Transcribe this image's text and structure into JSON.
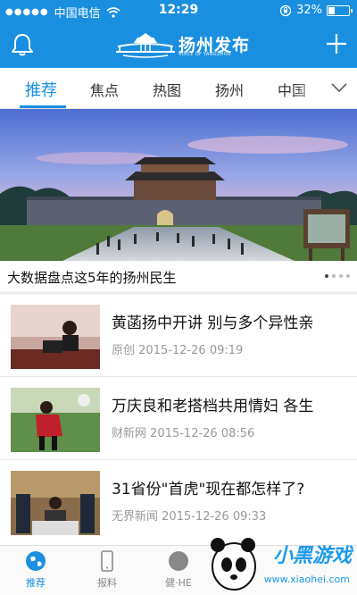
{
  "status_bar": {
    "carrier": "中国电信",
    "time": "12:29",
    "battery": "32%",
    "battery_level": 0.32
  },
  "header": {
    "title": "扬州发布",
    "subtitle": "VOICE OF YANGZHOU"
  },
  "tabs": [
    {
      "label": "推荐",
      "active": true
    },
    {
      "label": "焦点"
    },
    {
      "label": "热图"
    },
    {
      "label": "扬州"
    },
    {
      "label": "中国"
    }
  ],
  "banner": {
    "caption": "大数据盘点这5年的扬州民生",
    "pages": 4,
    "current_page": 1
  },
  "news": [
    {
      "title": "黄菡扬中开讲 别与多个异性亲",
      "source": "原创",
      "time": "2015-12-26 09:19"
    },
    {
      "title": "万庆良和老搭档共用情妇 各生",
      "source": "财新网",
      "time": "2015-12-26 08:56"
    },
    {
      "title": "31省份\"首虎\"现在都怎样了?",
      "source": "无界新闻",
      "time": "2015-12-26 09:33"
    }
  ],
  "bottom_tabs": [
    {
      "label": "推荐",
      "icon": "globe-icon",
      "active": true
    },
    {
      "label": "报料",
      "icon": "phone-icon"
    },
    {
      "label": "健·HE",
      "icon": "circle-icon"
    }
  ],
  "watermark": {
    "text": "小黑游戏",
    "url": "www.xiaohei.com"
  },
  "colors": {
    "brand_blue": "#1a8fe0",
    "meta_gray": "#999999"
  }
}
